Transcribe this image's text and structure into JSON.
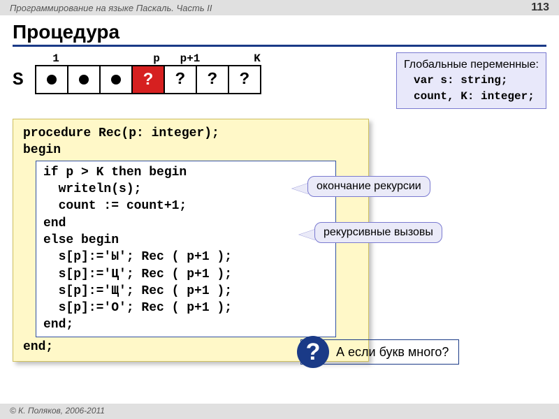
{
  "header": {
    "left": "Программирование на языке Паскаль. Часть II",
    "page": "113"
  },
  "title": "Процедура",
  "array": {
    "S": "S",
    "labels": {
      "c0": "1",
      "c1": "",
      "c2": "",
      "c3": "p",
      "c4": "p+1",
      "c5": "",
      "c6": "K"
    },
    "cells": {
      "red": "?",
      "q1": "?",
      "q2": "?",
      "q3": "?"
    }
  },
  "globals": {
    "title": "Глобальные переменные:",
    "line1": "var s: string;",
    "line2": "    count, K: integer;"
  },
  "code": {
    "l1": "procedure Rec(p: integer);",
    "l2": "begin",
    "inner": "if p > K then begin\n  writeln(s);\n  count := count+1;\nend\nelse begin\n  s[p]:='Ы'; Rec ( p+1 );\n  s[p]:='Ц'; Rec ( p+1 );\n  s[p]:='Щ'; Rec ( p+1 );\n  s[p]:='О'; Rec ( p+1 );\nend;",
    "l3": "end;"
  },
  "callouts": {
    "c1": "окончание рекурсии",
    "c2": "рекурсивные вызовы"
  },
  "question": {
    "badge": "?",
    "text": "А если букв много?"
  },
  "footer": "© К. Поляков, 2006-2011"
}
